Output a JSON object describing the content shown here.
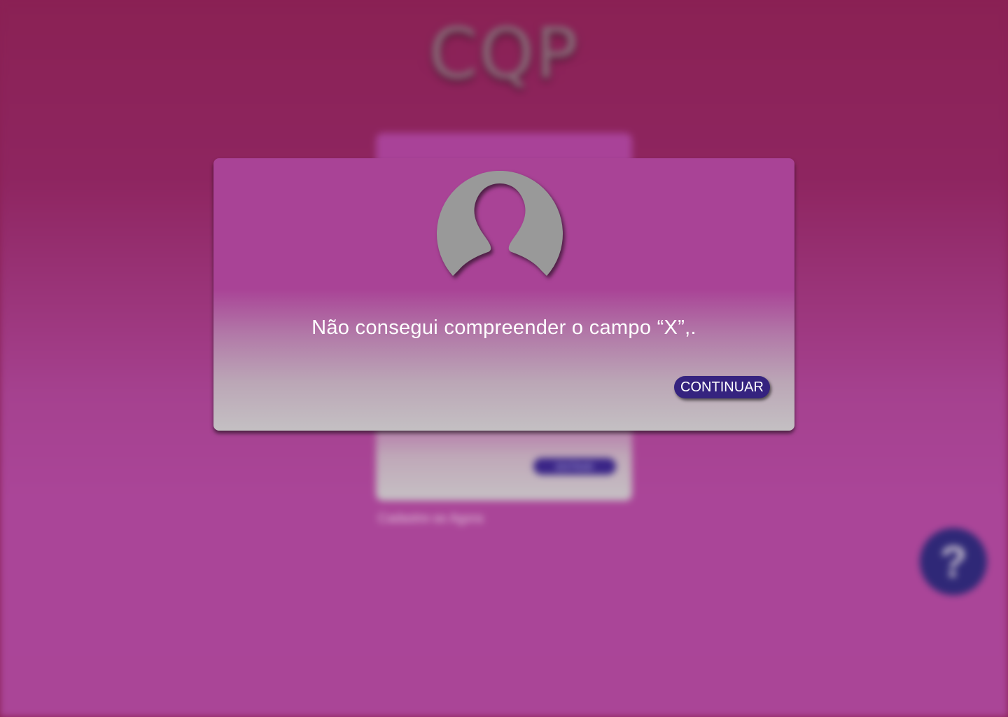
{
  "background": {
    "logo_text": "CQP",
    "enter_button_label": "ENTRAR",
    "signup_link": "Cadastre-se Agora",
    "help_button_label": "?"
  },
  "dialog": {
    "avatar_icon": "user-silhouette-icon",
    "message": "Não consegui compreender o campo “X”,.",
    "continue_label": "CONTINUAR"
  },
  "colors": {
    "page_top": "#8a2154",
    "page_bottom": "#aa4597",
    "dialog_top": "#a94396",
    "dialog_bottom": "#c4c0c3",
    "button": "#35237f",
    "avatar": "#999999"
  }
}
